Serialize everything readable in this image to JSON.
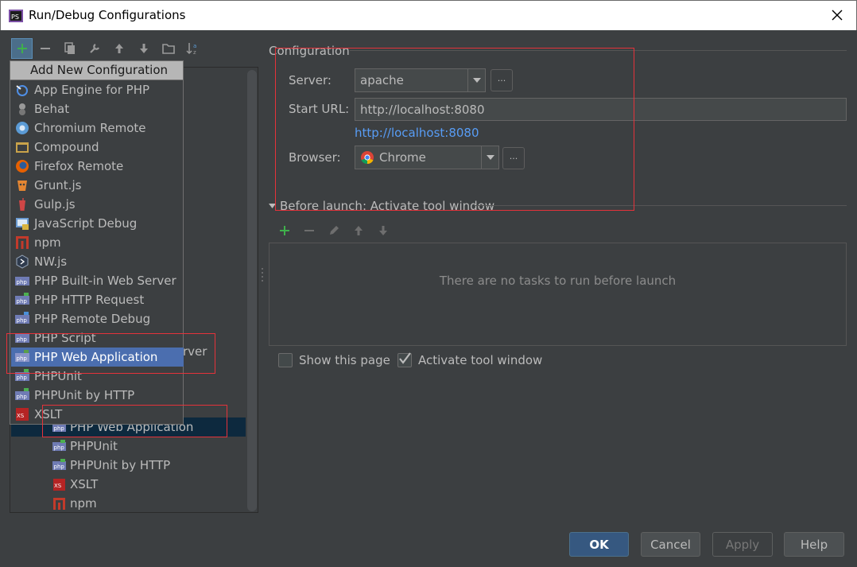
{
  "window": {
    "title": "Run/Debug Configurations",
    "close_glyph": "✕"
  },
  "tree": {
    "partial_hidden_text": "rver",
    "items": [
      {
        "label": "PHP Web Application",
        "icon": "php-web-app-icon"
      },
      {
        "label": "PHPUnit",
        "icon": "phpunit-icon"
      },
      {
        "label": "PHPUnit by HTTP",
        "icon": "phpunit-http-icon"
      },
      {
        "label": "XSLT",
        "icon": "xslt-icon"
      },
      {
        "label": "npm",
        "icon": "npm-icon"
      }
    ]
  },
  "popup": {
    "header": "Add New Configuration",
    "items": [
      {
        "label": "App Engine for PHP",
        "icon": "app-engine-icon"
      },
      {
        "label": "Behat",
        "icon": "behat-icon"
      },
      {
        "label": "Chromium Remote",
        "icon": "chromium-icon"
      },
      {
        "label": "Compound",
        "icon": "compound-icon"
      },
      {
        "label": "Firefox Remote",
        "icon": "firefox-icon"
      },
      {
        "label": "Grunt.js",
        "icon": "grunt-icon"
      },
      {
        "label": "Gulp.js",
        "icon": "gulp-icon"
      },
      {
        "label": "JavaScript Debug",
        "icon": "js-debug-icon"
      },
      {
        "label": "npm",
        "icon": "npm-icon"
      },
      {
        "label": "NW.js",
        "icon": "nwjs-icon"
      },
      {
        "label": "PHP Built-in Web Server",
        "icon": "php-builtin-icon"
      },
      {
        "label": "PHP HTTP Request",
        "icon": "php-http-icon"
      },
      {
        "label": "PHP Remote Debug",
        "icon": "php-remote-debug-icon"
      },
      {
        "label": "PHP Script",
        "icon": "php-script-icon"
      },
      {
        "label": "PHP Web Application",
        "icon": "php-web-app-icon"
      },
      {
        "label": "PHPUnit",
        "icon": "phpunit-icon"
      },
      {
        "label": "PHPUnit by HTTP",
        "icon": "phpunit-http-icon"
      },
      {
        "label": "XSLT",
        "icon": "xslt-icon"
      }
    ]
  },
  "config": {
    "section_title": "Configuration",
    "server_label": "Server:",
    "server_value": "apache",
    "start_url_label": "Start URL:",
    "start_url_value": "http://localhost:8080",
    "start_url_link": "http://localhost:8080",
    "browser_label": "Browser:",
    "browser_value": "Chrome",
    "dots": "···"
  },
  "before_launch": {
    "title": "Before launch: Activate tool window",
    "empty_text": "There are no tasks to run before launch"
  },
  "options": {
    "show_page_label": "Show this page",
    "show_page_checked": false,
    "activate_tool_label": "Activate tool window",
    "activate_tool_checked": true
  },
  "buttons": {
    "ok": "OK",
    "cancel": "Cancel",
    "apply": "Apply",
    "help": "Help"
  },
  "colors": {
    "background": "#3c3f41",
    "highlight": "#4b6eaf",
    "selection": "#0d293e",
    "link": "#589df6",
    "annotation": "#e5323a",
    "add_green": "#3fb04b"
  }
}
